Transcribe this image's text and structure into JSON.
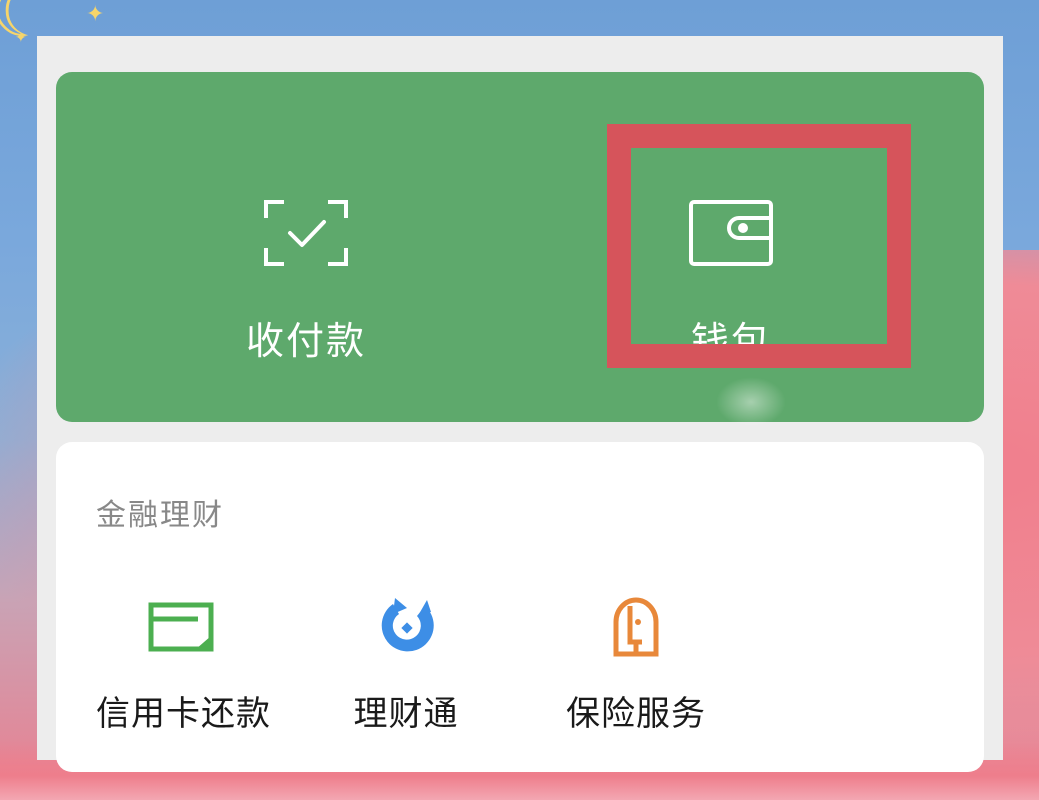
{
  "top_panel": {
    "items": [
      {
        "label": "收付款",
        "icon": "scan-check-icon"
      },
      {
        "label": "钱包",
        "icon": "wallet-icon"
      }
    ]
  },
  "finance": {
    "title": "金融理财",
    "items": [
      {
        "label": "信用卡还款",
        "icon": "credit-card-icon",
        "color": "#4caf50"
      },
      {
        "label": "理财通",
        "icon": "licaitong-icon",
        "color": "#3d8ee6"
      },
      {
        "label": "保险服务",
        "icon": "insurance-icon",
        "color": "#e8883a"
      }
    ]
  },
  "colors": {
    "panel_green": "#5ea96c",
    "highlight_red": "#d6545b"
  }
}
